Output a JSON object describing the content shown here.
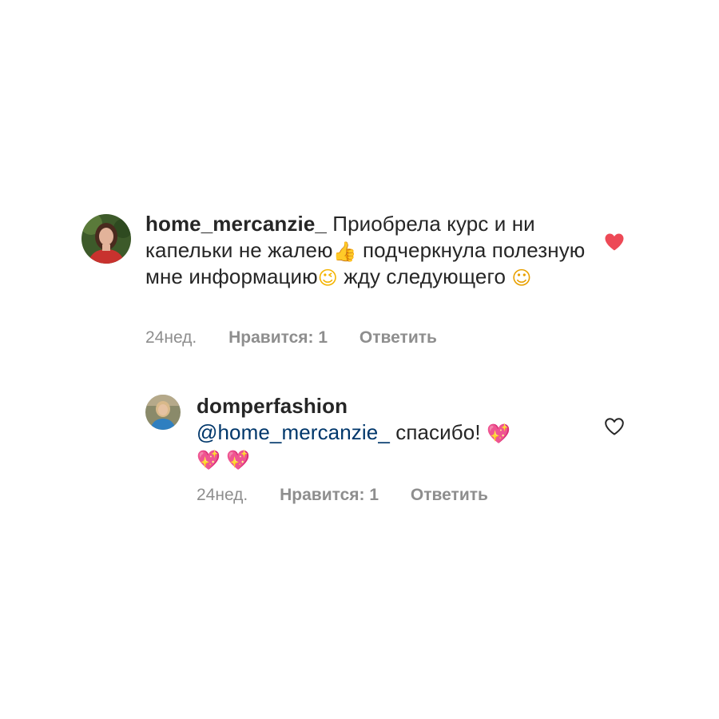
{
  "comments": [
    {
      "username": "home_mercanzie_",
      "text_parts": [
        "Приобрела курс и ни капельки не жалею",
        " подчеркнула полезную мне информацию",
        " жду следующего "
      ],
      "emojis": [
        "👍",
        "😉",
        "☺"
      ],
      "time": "24нед.",
      "likes": "Нравится: 1",
      "reply_label": "Ответить",
      "liked": true,
      "like_color": "#ed4956",
      "avatar_icon": "profile-photo"
    },
    {
      "username": "domperfashion",
      "mention": "@home_mercanzie_",
      "text": " спасибо! ",
      "emojis": [
        "💖",
        "💖",
        "💖"
      ],
      "time": "24нед.",
      "likes": "Нравится: 1",
      "reply_label": "Ответить",
      "liked": false,
      "like_color": "#262626",
      "avatar_icon": "profile-photo"
    }
  ]
}
